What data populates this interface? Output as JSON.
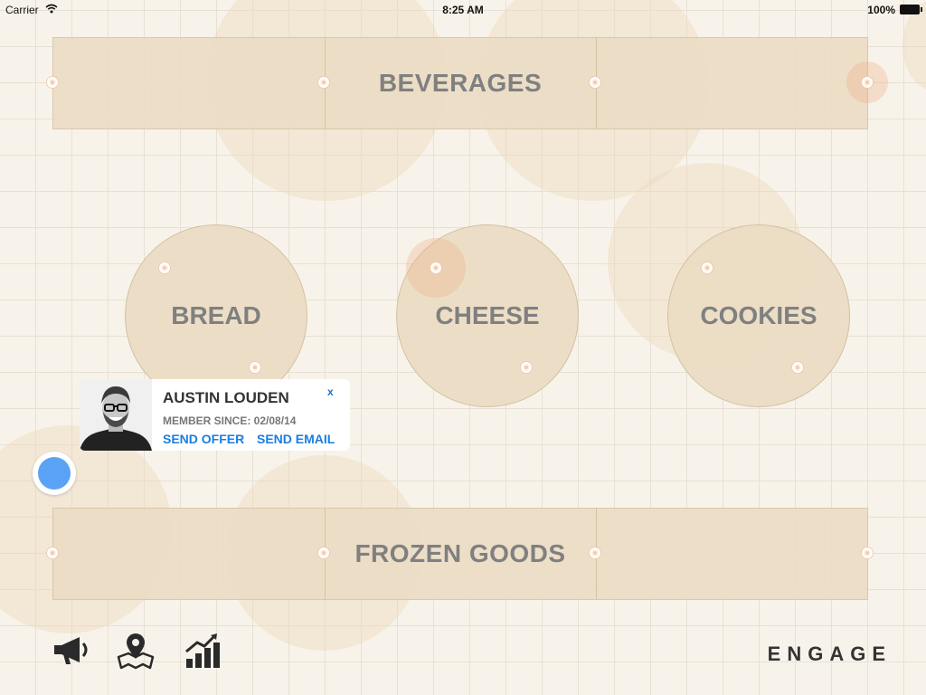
{
  "status_bar": {
    "carrier": "Carrier",
    "time": "8:25 AM",
    "battery": "100%"
  },
  "shelves": [
    {
      "label": "BEVERAGES"
    },
    {
      "label": "FROZEN GOODS"
    }
  ],
  "tables": [
    {
      "label": "BREAD"
    },
    {
      "label": "CHEESE"
    },
    {
      "label": "COOKIES"
    }
  ],
  "customer_card": {
    "name": "AUSTIN LOUDEN",
    "member_since": "MEMBER SINCE: 02/08/14",
    "send_offer": "SEND OFFER",
    "send_email": "SEND EMAIL",
    "close": "x"
  },
  "toolbar": {
    "icons": [
      "megaphone-icon",
      "map-pin-icon",
      "chart-growth-icon"
    ]
  },
  "brand": "ENGAGE",
  "colors": {
    "accent": "#1a7ee0",
    "location_dot": "#5aa2f5",
    "label_gray": "#808080"
  }
}
